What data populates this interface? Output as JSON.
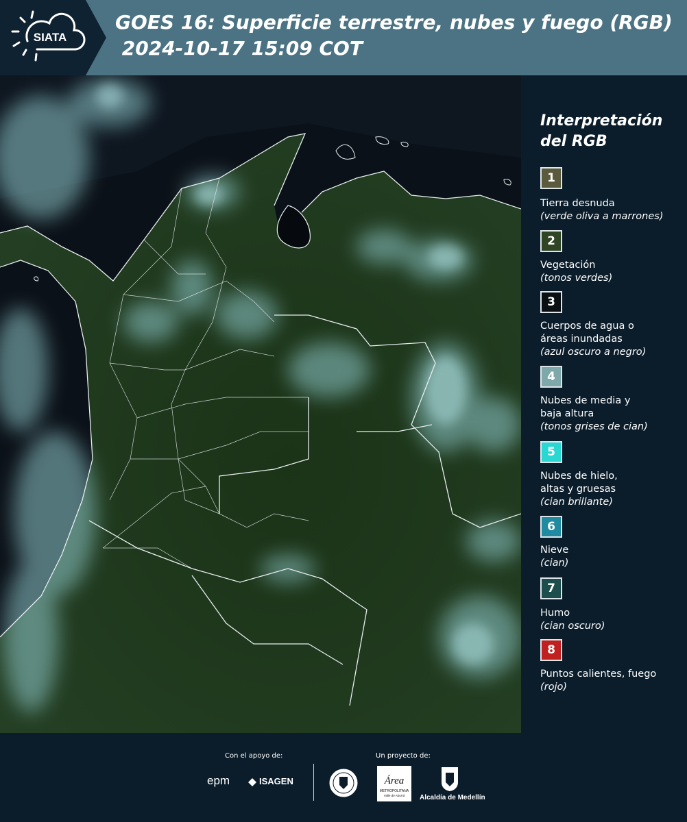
{
  "header": {
    "logo_text": "SIATA",
    "title": "GOES 16: Superficie terrestre, nubes y fuego (RGB)\n 2024-10-17 15:09 COT"
  },
  "legend": {
    "title": "Interpretación del RGB",
    "items": [
      {
        "number": "1",
        "label": "Tierra desnuda",
        "desc": "(verde oliva a marrones)",
        "color": "#5c5a3c"
      },
      {
        "number": "2",
        "label": "Vegetación",
        "desc": "(tonos verdes)",
        "color": "#2f4524"
      },
      {
        "number": "3",
        "label": "Cuerpos de agua o\náreas inundadas",
        "desc": "(azul oscuro a negro)",
        "color": "#0a0f14"
      },
      {
        "number": "4",
        "label": "Nubes de media y\nbaja altura",
        "desc": "(tonos grises de cian)",
        "color": "#7fa8aa"
      },
      {
        "number": "5",
        "label": "Nubes de hielo,\naltas y gruesas",
        "desc": "(cian brillante)",
        "color": "#29d7d3"
      },
      {
        "number": "6",
        "label": "Nieve",
        "desc": "(cian)",
        "color": "#1f8aa0"
      },
      {
        "number": "7",
        "label": "Humo",
        "desc": "(cian oscuro)",
        "color": "#1d4d4d"
      },
      {
        "number": "8",
        "label": "Puntos calientes, fuego",
        "desc": "(rojo)",
        "color": "#c0201f"
      }
    ]
  },
  "footer": {
    "support_label": "Con el apoyo de:",
    "project_label": "Un proyecto de:",
    "sponsors": [
      "epm",
      "ISAGEN"
    ],
    "metro_text": "Área",
    "metro_sub": "METROPOLITANA",
    "metro_sub2": "Valle de Aburrá",
    "alcaldia": "Alcaldía de Medellín"
  }
}
